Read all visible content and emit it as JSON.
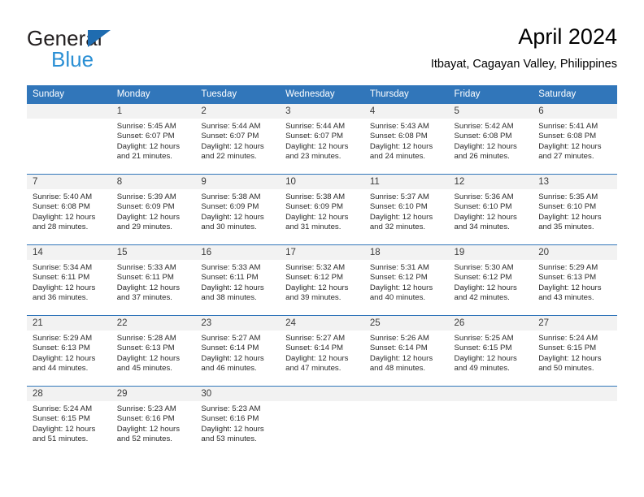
{
  "brand": {
    "name_part1": "General",
    "name_part2": "Blue",
    "triangle_color": "#1f6cb0",
    "blue_text_color": "#2a8fd4"
  },
  "header": {
    "title": "April 2024",
    "subtitle": "Itbayat, Cagayan Valley, Philippines"
  },
  "theme": {
    "header_blue": "#3176ba",
    "daynum_band": "#f2f2f2",
    "body_text": "#2b2b2b"
  },
  "calendar": {
    "weekday_headers": [
      "Sunday",
      "Monday",
      "Tuesday",
      "Wednesday",
      "Thursday",
      "Friday",
      "Saturday"
    ],
    "weeks": [
      [
        {
          "day": "",
          "sunrise": "",
          "sunset": "",
          "daylight_line1": "",
          "daylight_line2": ""
        },
        {
          "day": "1",
          "sunrise": "Sunrise: 5:45 AM",
          "sunset": "Sunset: 6:07 PM",
          "daylight_line1": "Daylight: 12 hours",
          "daylight_line2": "and 21 minutes."
        },
        {
          "day": "2",
          "sunrise": "Sunrise: 5:44 AM",
          "sunset": "Sunset: 6:07 PM",
          "daylight_line1": "Daylight: 12 hours",
          "daylight_line2": "and 22 minutes."
        },
        {
          "day": "3",
          "sunrise": "Sunrise: 5:44 AM",
          "sunset": "Sunset: 6:07 PM",
          "daylight_line1": "Daylight: 12 hours",
          "daylight_line2": "and 23 minutes."
        },
        {
          "day": "4",
          "sunrise": "Sunrise: 5:43 AM",
          "sunset": "Sunset: 6:08 PM",
          "daylight_line1": "Daylight: 12 hours",
          "daylight_line2": "and 24 minutes."
        },
        {
          "day": "5",
          "sunrise": "Sunrise: 5:42 AM",
          "sunset": "Sunset: 6:08 PM",
          "daylight_line1": "Daylight: 12 hours",
          "daylight_line2": "and 26 minutes."
        },
        {
          "day": "6",
          "sunrise": "Sunrise: 5:41 AM",
          "sunset": "Sunset: 6:08 PM",
          "daylight_line1": "Daylight: 12 hours",
          "daylight_line2": "and 27 minutes."
        }
      ],
      [
        {
          "day": "7",
          "sunrise": "Sunrise: 5:40 AM",
          "sunset": "Sunset: 6:08 PM",
          "daylight_line1": "Daylight: 12 hours",
          "daylight_line2": "and 28 minutes."
        },
        {
          "day": "8",
          "sunrise": "Sunrise: 5:39 AM",
          "sunset": "Sunset: 6:09 PM",
          "daylight_line1": "Daylight: 12 hours",
          "daylight_line2": "and 29 minutes."
        },
        {
          "day": "9",
          "sunrise": "Sunrise: 5:38 AM",
          "sunset": "Sunset: 6:09 PM",
          "daylight_line1": "Daylight: 12 hours",
          "daylight_line2": "and 30 minutes."
        },
        {
          "day": "10",
          "sunrise": "Sunrise: 5:38 AM",
          "sunset": "Sunset: 6:09 PM",
          "daylight_line1": "Daylight: 12 hours",
          "daylight_line2": "and 31 minutes."
        },
        {
          "day": "11",
          "sunrise": "Sunrise: 5:37 AM",
          "sunset": "Sunset: 6:10 PM",
          "daylight_line1": "Daylight: 12 hours",
          "daylight_line2": "and 32 minutes."
        },
        {
          "day": "12",
          "sunrise": "Sunrise: 5:36 AM",
          "sunset": "Sunset: 6:10 PM",
          "daylight_line1": "Daylight: 12 hours",
          "daylight_line2": "and 34 minutes."
        },
        {
          "day": "13",
          "sunrise": "Sunrise: 5:35 AM",
          "sunset": "Sunset: 6:10 PM",
          "daylight_line1": "Daylight: 12 hours",
          "daylight_line2": "and 35 minutes."
        }
      ],
      [
        {
          "day": "14",
          "sunrise": "Sunrise: 5:34 AM",
          "sunset": "Sunset: 6:11 PM",
          "daylight_line1": "Daylight: 12 hours",
          "daylight_line2": "and 36 minutes."
        },
        {
          "day": "15",
          "sunrise": "Sunrise: 5:33 AM",
          "sunset": "Sunset: 6:11 PM",
          "daylight_line1": "Daylight: 12 hours",
          "daylight_line2": "and 37 minutes."
        },
        {
          "day": "16",
          "sunrise": "Sunrise: 5:33 AM",
          "sunset": "Sunset: 6:11 PM",
          "daylight_line1": "Daylight: 12 hours",
          "daylight_line2": "and 38 minutes."
        },
        {
          "day": "17",
          "sunrise": "Sunrise: 5:32 AM",
          "sunset": "Sunset: 6:12 PM",
          "daylight_line1": "Daylight: 12 hours",
          "daylight_line2": "and 39 minutes."
        },
        {
          "day": "18",
          "sunrise": "Sunrise: 5:31 AM",
          "sunset": "Sunset: 6:12 PM",
          "daylight_line1": "Daylight: 12 hours",
          "daylight_line2": "and 40 minutes."
        },
        {
          "day": "19",
          "sunrise": "Sunrise: 5:30 AM",
          "sunset": "Sunset: 6:12 PM",
          "daylight_line1": "Daylight: 12 hours",
          "daylight_line2": "and 42 minutes."
        },
        {
          "day": "20",
          "sunrise": "Sunrise: 5:29 AM",
          "sunset": "Sunset: 6:13 PM",
          "daylight_line1": "Daylight: 12 hours",
          "daylight_line2": "and 43 minutes."
        }
      ],
      [
        {
          "day": "21",
          "sunrise": "Sunrise: 5:29 AM",
          "sunset": "Sunset: 6:13 PM",
          "daylight_line1": "Daylight: 12 hours",
          "daylight_line2": "and 44 minutes."
        },
        {
          "day": "22",
          "sunrise": "Sunrise: 5:28 AM",
          "sunset": "Sunset: 6:13 PM",
          "daylight_line1": "Daylight: 12 hours",
          "daylight_line2": "and 45 minutes."
        },
        {
          "day": "23",
          "sunrise": "Sunrise: 5:27 AM",
          "sunset": "Sunset: 6:14 PM",
          "daylight_line1": "Daylight: 12 hours",
          "daylight_line2": "and 46 minutes."
        },
        {
          "day": "24",
          "sunrise": "Sunrise: 5:27 AM",
          "sunset": "Sunset: 6:14 PM",
          "daylight_line1": "Daylight: 12 hours",
          "daylight_line2": "and 47 minutes."
        },
        {
          "day": "25",
          "sunrise": "Sunrise: 5:26 AM",
          "sunset": "Sunset: 6:14 PM",
          "daylight_line1": "Daylight: 12 hours",
          "daylight_line2": "and 48 minutes."
        },
        {
          "day": "26",
          "sunrise": "Sunrise: 5:25 AM",
          "sunset": "Sunset: 6:15 PM",
          "daylight_line1": "Daylight: 12 hours",
          "daylight_line2": "and 49 minutes."
        },
        {
          "day": "27",
          "sunrise": "Sunrise: 5:24 AM",
          "sunset": "Sunset: 6:15 PM",
          "daylight_line1": "Daylight: 12 hours",
          "daylight_line2": "and 50 minutes."
        }
      ],
      [
        {
          "day": "28",
          "sunrise": "Sunrise: 5:24 AM",
          "sunset": "Sunset: 6:15 PM",
          "daylight_line1": "Daylight: 12 hours",
          "daylight_line2": "and 51 minutes."
        },
        {
          "day": "29",
          "sunrise": "Sunrise: 5:23 AM",
          "sunset": "Sunset: 6:16 PM",
          "daylight_line1": "Daylight: 12 hours",
          "daylight_line2": "and 52 minutes."
        },
        {
          "day": "30",
          "sunrise": "Sunrise: 5:23 AM",
          "sunset": "Sunset: 6:16 PM",
          "daylight_line1": "Daylight: 12 hours",
          "daylight_line2": "and 53 minutes."
        },
        {
          "day": "",
          "sunrise": "",
          "sunset": "",
          "daylight_line1": "",
          "daylight_line2": ""
        },
        {
          "day": "",
          "sunrise": "",
          "sunset": "",
          "daylight_line1": "",
          "daylight_line2": ""
        },
        {
          "day": "",
          "sunrise": "",
          "sunset": "",
          "daylight_line1": "",
          "daylight_line2": ""
        },
        {
          "day": "",
          "sunrise": "",
          "sunset": "",
          "daylight_line1": "",
          "daylight_line2": ""
        }
      ]
    ]
  }
}
